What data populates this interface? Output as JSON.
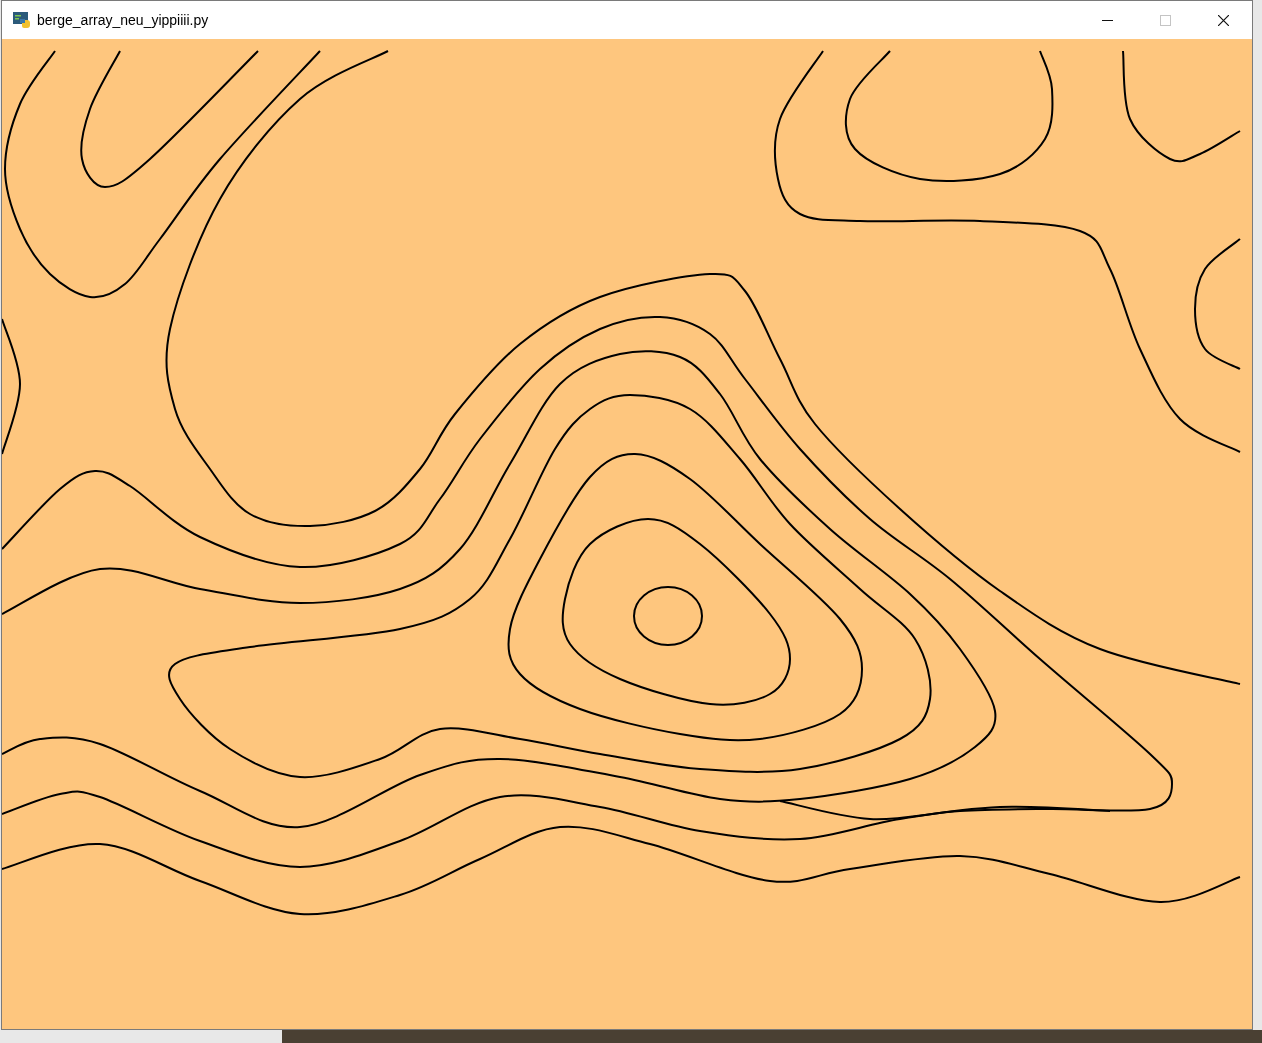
{
  "window": {
    "title": "berge_array_neu_yippiiii.py",
    "controls": [
      {
        "kind": "minimize",
        "disabled": false
      },
      {
        "kind": "maximize",
        "disabled": true
      },
      {
        "kind": "close",
        "disabled": false
      }
    ]
  }
}
